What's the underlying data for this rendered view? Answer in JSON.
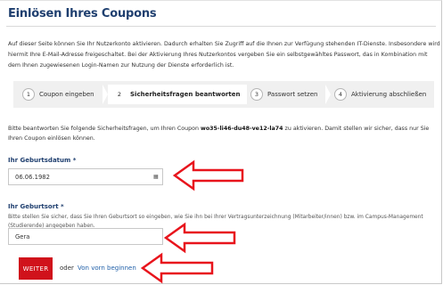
{
  "page": {
    "title": "Einlösen Ihres Coupons",
    "intro": "Auf dieser Seite können Sie Ihr Nutzerkonto aktivieren. Dadurch erhalten Sie Zugriff auf die Ihnen zur Verfügung stehenden IT-Dienste. Insbesondere wird hiermit Ihre E-Mail-Adresse freigeschaltet. Bei der Aktivierung Ihres Nutzerkontos vergeben Sie ein selbstgewähltes Passwort, das in Kombination mit dem Ihnen zugewiesenen Login-Namen zur Nutzung der Dienste erforderlich ist."
  },
  "steps": [
    {
      "num": "1",
      "label": "Coupon eingeben",
      "active": false
    },
    {
      "num": "2",
      "label": "Sicherheitsfragen beantworten",
      "active": true
    },
    {
      "num": "3",
      "label": "Passwort setzen",
      "active": false
    },
    {
      "num": "4",
      "label": "Aktivierung abschließen",
      "active": false
    }
  ],
  "answer": {
    "before": "Bitte beantworten Sie folgende Sicherheitsfragen, um Ihren Coupon ",
    "coupon": "wo35-li46-du48-ve12-la74",
    "after": " zu aktivieren. Damit stellen wir sicher, dass nur Sie Ihren Coupon einlösen können."
  },
  "birthdate": {
    "label": "Ihr Geburtsdatum *",
    "value": "06.06.1982",
    "icon": "calendar-icon"
  },
  "birthplace": {
    "label": "Ihr Geburtsort *",
    "help": "Bitte stellen Sie sicher, dass Sie Ihren Geburtsort so eingeben, wie Sie ihn bei Ihrer Vertragsunterzeichnung (Mitarbeiter/innen) bzw. im Campus-Management (Studierende) angegeben haben.",
    "value": "Gera"
  },
  "actions": {
    "submit_label": "WEITER",
    "or_text": "oder",
    "restart_label": "Von vorn beginnen"
  },
  "colors": {
    "heading": "#1f3f6f",
    "button": "#d0121b",
    "arrow": "#e8141c",
    "link": "#1f5fa8"
  }
}
